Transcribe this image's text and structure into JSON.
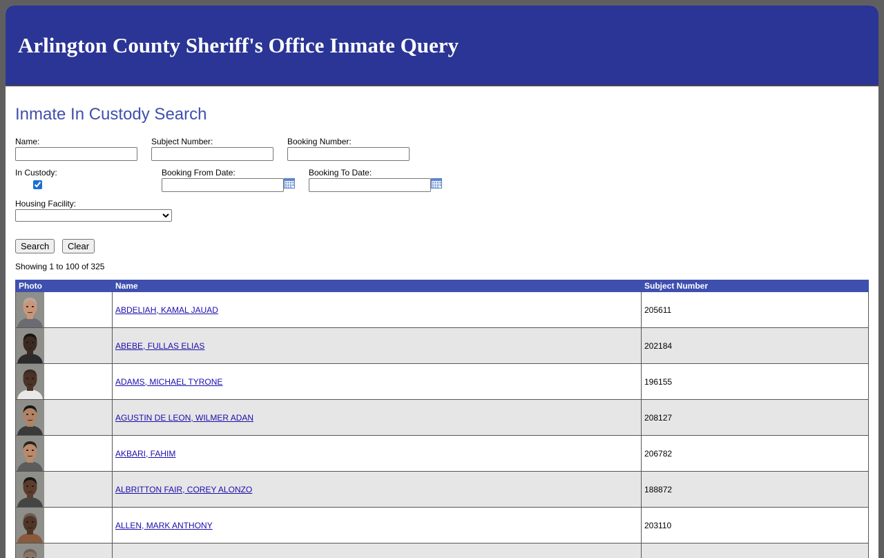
{
  "header": {
    "title": "Arlington County Sheriff's Office Inmate Query"
  },
  "search": {
    "title": "Inmate In Custody Search",
    "name_label": "Name:",
    "name_value": "",
    "subject_label": "Subject Number:",
    "subject_value": "",
    "booking_label": "Booking Number:",
    "booking_value": "",
    "custody_label": "In Custody:",
    "custody_checked": true,
    "from_label": "Booking From Date:",
    "from_value": "",
    "to_label": "Booking To Date:",
    "to_value": "",
    "housing_label": "Housing Facility:",
    "housing_selected": "",
    "search_button": "Search",
    "clear_button": "Clear"
  },
  "results": {
    "summary": "Showing 1 to 100 of 325",
    "columns": [
      "Photo",
      "Name",
      "Subject Number"
    ],
    "rows": [
      {
        "name": "ABDELIAH, KAMAL JAUAD",
        "subject": "205611",
        "skin": "#c9967a",
        "hair": "#b5aaa0",
        "shirt": "#6b6b73"
      },
      {
        "name": "ABEBE, FULLAS ELIAS",
        "subject": "202184",
        "skin": "#3a2a22",
        "hair": "#1a1412",
        "shirt": "#2b2b2b"
      },
      {
        "name": "ADAMS, MICHAEL TYRONE",
        "subject": "196155",
        "skin": "#4a3326",
        "hair": "#3b2a20",
        "shirt": "#e8e8e8"
      },
      {
        "name": "AGUSTIN DE LEON, WILMER ADAN",
        "subject": "208127",
        "skin": "#b08266",
        "hair": "#1b1714",
        "shirt": "#3a3a3a"
      },
      {
        "name": "AKBARI, FAHIM",
        "subject": "206782",
        "skin": "#b98a6c",
        "hair": "#2a221d",
        "shirt": "#5c5c5c"
      },
      {
        "name": "ALBRITTON FAIR, COREY ALONZO",
        "subject": "188872",
        "skin": "#5a3d2c",
        "hair": "#1a1410",
        "shirt": "#444444"
      },
      {
        "name": "ALLEN, MARK ANTHONY",
        "subject": "203110",
        "skin": "#4f3527",
        "hair": "#6b5d52",
        "shirt": "#8a5a3c"
      },
      {
        "name": "",
        "subject": "",
        "skin": "#8a7466",
        "hair": "#6c6058",
        "shirt": "#6f6f6f"
      }
    ]
  }
}
